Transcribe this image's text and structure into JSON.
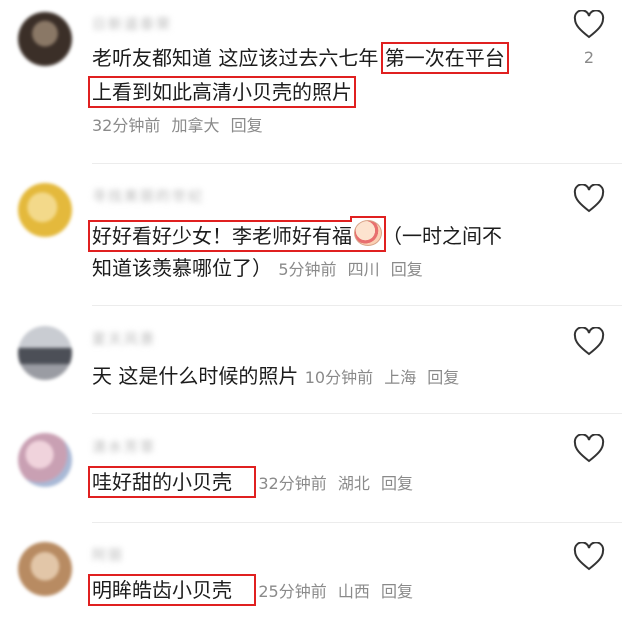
{
  "comments": [
    {
      "username": "日新道泰荣",
      "line1_plain": "老听友都知道 这应该过去六七年",
      "line1_hl": "第一次在平台",
      "line2_hl": "上看到如此高清小贝壳的照片",
      "time": "32分钟前",
      "location": "加拿大",
      "reply": "回复",
      "likes": "2",
      "avatar_color": "#5a4a3e"
    },
    {
      "username": "寻找美丽的世纪",
      "line1_hl": "好好看好少女！李老师好有福",
      "line1_rest": "（一时之间不",
      "line2_plain": "知道该羡慕哪位了）",
      "time": "5分钟前",
      "location": "四川",
      "reply": "回复",
      "avatar_color": "#e9c64a"
    },
    {
      "username": "夏天风景",
      "line1_plain": "天 这是什么时候的照片",
      "time": "10分钟前",
      "location": "上海",
      "reply": "回复",
      "avatar_color": "#5b5e66"
    },
    {
      "username": "清水芳草",
      "line1_hl": "哇好甜的小贝壳",
      "time": "32分钟前",
      "location": "湖北",
      "reply": "回复",
      "avatar_color": "#d9a9b8"
    },
    {
      "username": "阿丽",
      "line1_hl": "明眸皓齿小贝壳",
      "time": "25分钟前",
      "location": "山西",
      "reply": "回复",
      "avatar_color": "#c99f7a"
    }
  ],
  "colors": {
    "highlight_box": "#e02020",
    "meta_gray": "#8a8a8a"
  }
}
